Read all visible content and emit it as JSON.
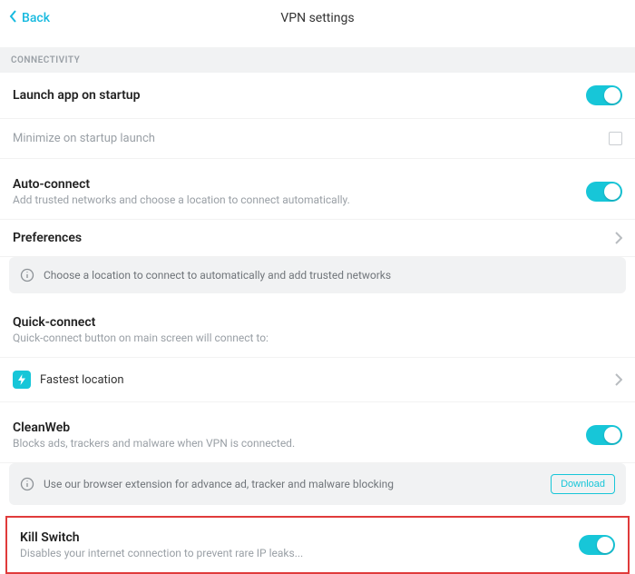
{
  "header": {
    "back_label": "Back",
    "title": "VPN settings"
  },
  "section_connectivity": "CONNECTIVITY",
  "launch": {
    "title": "Launch app on startup"
  },
  "minimize": {
    "title": "Minimize on startup launch"
  },
  "autoconnect": {
    "title": "Auto-connect",
    "sub": "Add trusted networks and choose a location to connect automatically."
  },
  "preferences": {
    "title": "Preferences",
    "info": "Choose a location to connect to automatically and add trusted networks"
  },
  "quickconnect": {
    "title": "Quick-connect",
    "sub": "Quick-connect button on main screen will connect to:",
    "fastest": "Fastest location"
  },
  "cleanweb": {
    "title": "CleanWeb",
    "sub": "Blocks ads, trackers and malware when VPN is connected.",
    "info": "Use our browser extension for advance ad, tracker and malware blocking",
    "download": "Download"
  },
  "killswitch": {
    "title": "Kill Switch",
    "sub": "Disables your internet connection to prevent rare IP leaks..."
  }
}
